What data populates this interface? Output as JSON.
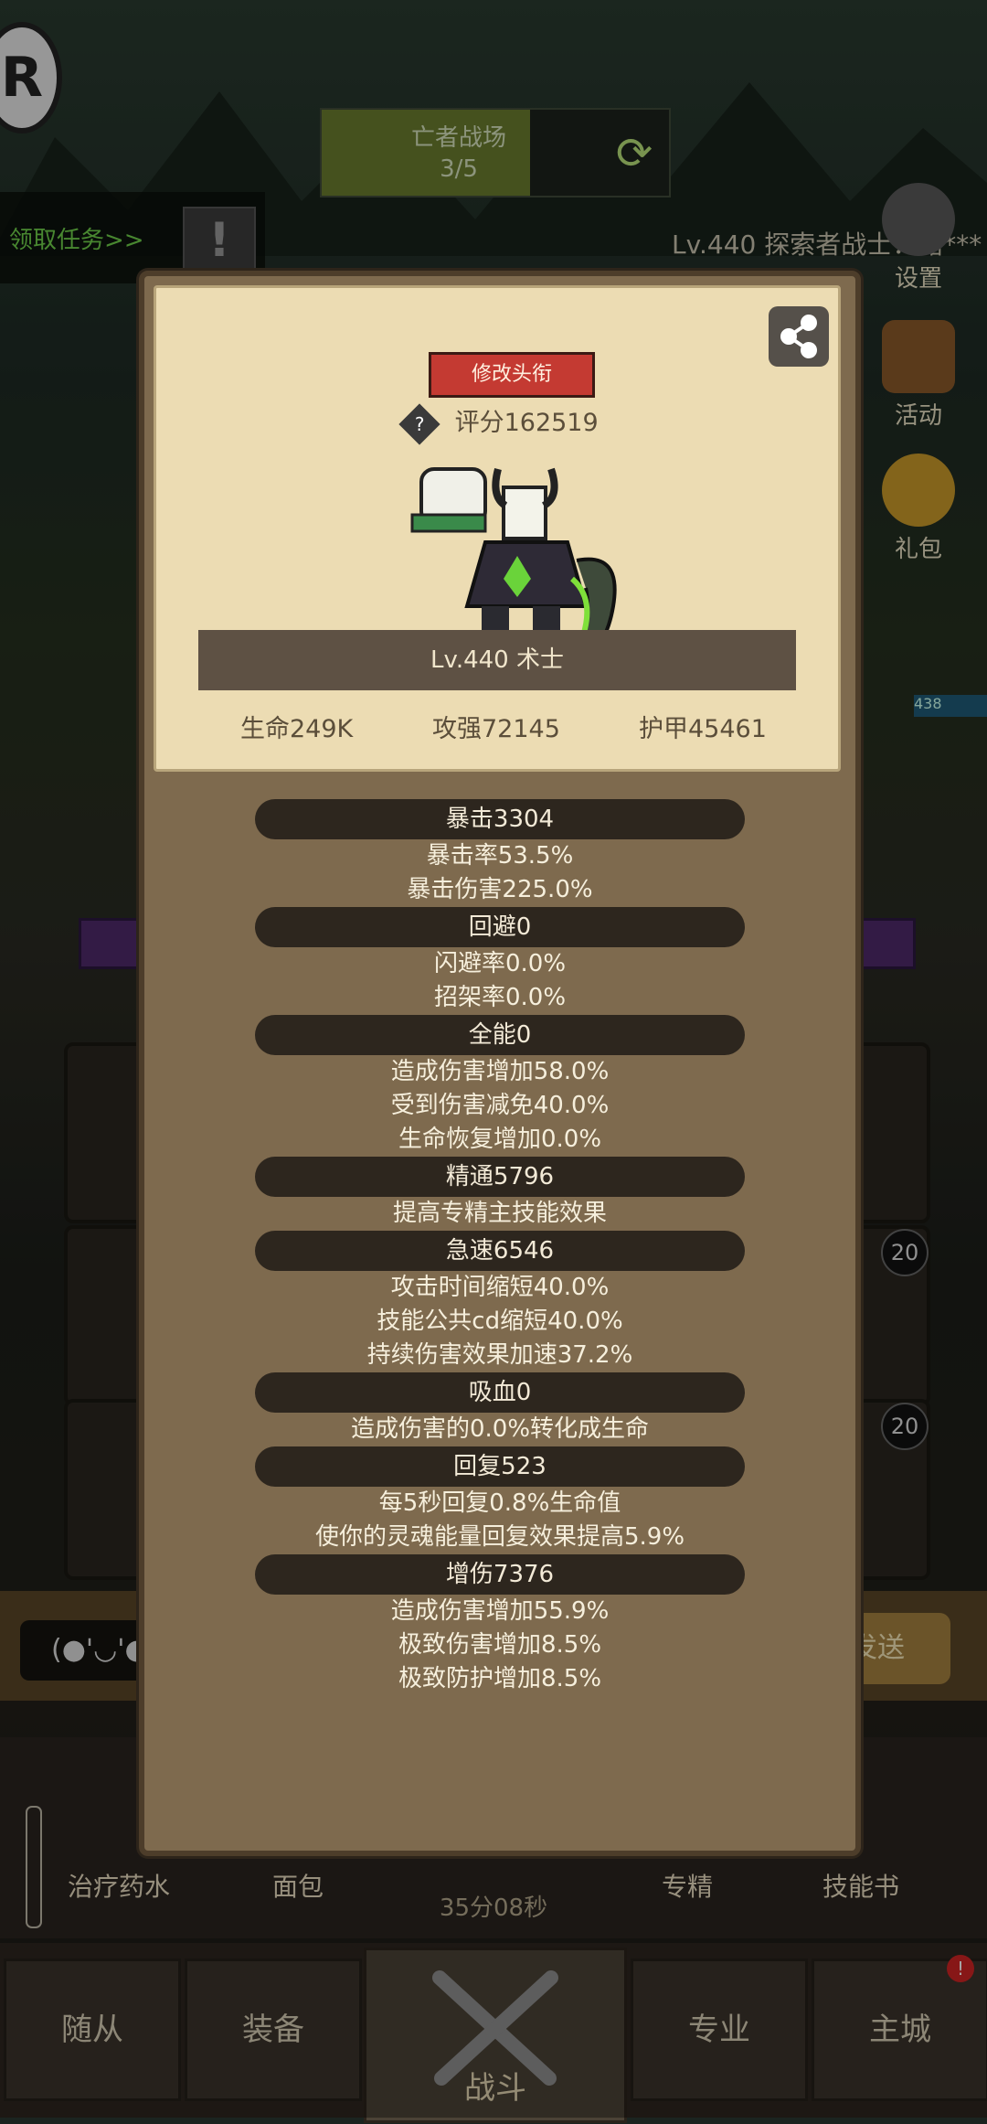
{
  "hud": {
    "stage_title": "亡者战场",
    "stage_progress": "3/5",
    "task_label": "领取任务>>",
    "player_name": "Lv.440 探索者战士：路***",
    "side_buttons": [
      {
        "label": "设置",
        "icon": "gear-icon"
      },
      {
        "label": "活动",
        "icon": "scroll-icon"
      },
      {
        "label": "礼包",
        "icon": "gift-icon"
      }
    ],
    "hp_badge": "438",
    "chat_placeholder": "(●'◡'●",
    "send_label": "发送",
    "bottom_items": [
      "治疗药水",
      "面包",
      "专精",
      "技能书"
    ],
    "timer": "35分08秒",
    "slot_badge_1": "20",
    "slot_badge_2": "20",
    "notification": "!"
  },
  "tabs": {
    "left": [
      "随从",
      "装备"
    ],
    "battle": "战斗",
    "right": [
      "专业",
      "主城"
    ]
  },
  "profile": {
    "modify_title_label": "修改头衔",
    "score_label": "评分162519",
    "name_banner": "Lv.440 术士",
    "stats": {
      "hp": "生命249K",
      "attack": "攻强72145",
      "armor": "护甲45461"
    }
  },
  "stat_groups": [
    {
      "header": "暴击3304",
      "lines": [
        "暴击率53.5%",
        "暴击伤害225.0%"
      ]
    },
    {
      "header": "回避0",
      "lines": [
        "闪避率0.0%",
        "招架率0.0%"
      ]
    },
    {
      "header": "全能0",
      "lines": [
        "造成伤害增加58.0%",
        "受到伤害减免40.0%",
        "生命恢复增加0.0%"
      ]
    },
    {
      "header": "精通5796",
      "lines": [
        "提高专精主技能效果"
      ]
    },
    {
      "header": "急速6546",
      "lines": [
        "攻击时间缩短40.0%",
        "技能公共cd缩短40.0%",
        "持续伤害效果加速37.2%"
      ]
    },
    {
      "header": "吸血0",
      "lines": [
        "造成伤害的0.0%转化成生命"
      ]
    },
    {
      "header": "回复523",
      "lines": [
        "每5秒回复0.8%生命值",
        "使你的灵魂能量回复效果提高5.9%"
      ]
    },
    {
      "header": "增伤7376",
      "lines": [
        "造成伤害增加55.9%",
        "极致伤害增加8.5%",
        "极致防护增加8.5%"
      ]
    }
  ]
}
